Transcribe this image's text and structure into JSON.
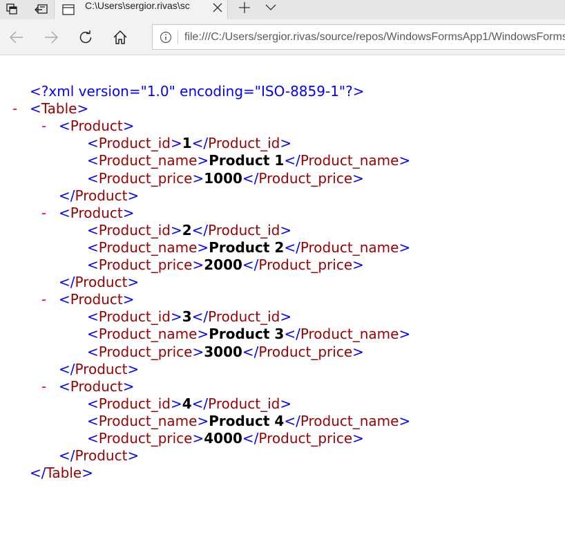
{
  "browser": {
    "tab_title": "C:\\Users\\sergior.rivas\\sc",
    "address_url": "file:///C:/Users/sergior.rivas/source/repos/WindowsFormsApp1/WindowsForms",
    "icons": [
      "tab-preview-icon",
      "set-aside-tabs-icon",
      "page-icon",
      "close-icon",
      "plus-icon",
      "chevron-down-icon",
      "back-arrow-icon",
      "forward-arrow-icon",
      "refresh-icon",
      "home-icon",
      "info-icon"
    ]
  },
  "xml": {
    "declaration": "<?xml version=\"1.0\" encoding=\"ISO-8859-1\"?>",
    "root_tag": "Table",
    "child_tag": "Product",
    "collapse_marker": "-",
    "open_bracket": "<",
    "close_open_bracket": "</",
    "end_bracket": ">",
    "fields": [
      "Product_id",
      "Product_name",
      "Product_price"
    ],
    "products": [
      {
        "id": "1",
        "name": "Product 1",
        "price": "1000"
      },
      {
        "id": "2",
        "name": "Product 2",
        "price": "2000"
      },
      {
        "id": "3",
        "name": "Product 3",
        "price": "3000"
      },
      {
        "id": "4",
        "name": "Product 4",
        "price": "4000"
      }
    ]
  },
  "colors": {
    "bracket": "#0000ff",
    "tag_name": "#990000",
    "text_value": "#000000",
    "collapse_marker": "#ff0000",
    "tabstrip_bg": "#e6e6e6",
    "toolbar_bg": "#f2f2f2"
  }
}
